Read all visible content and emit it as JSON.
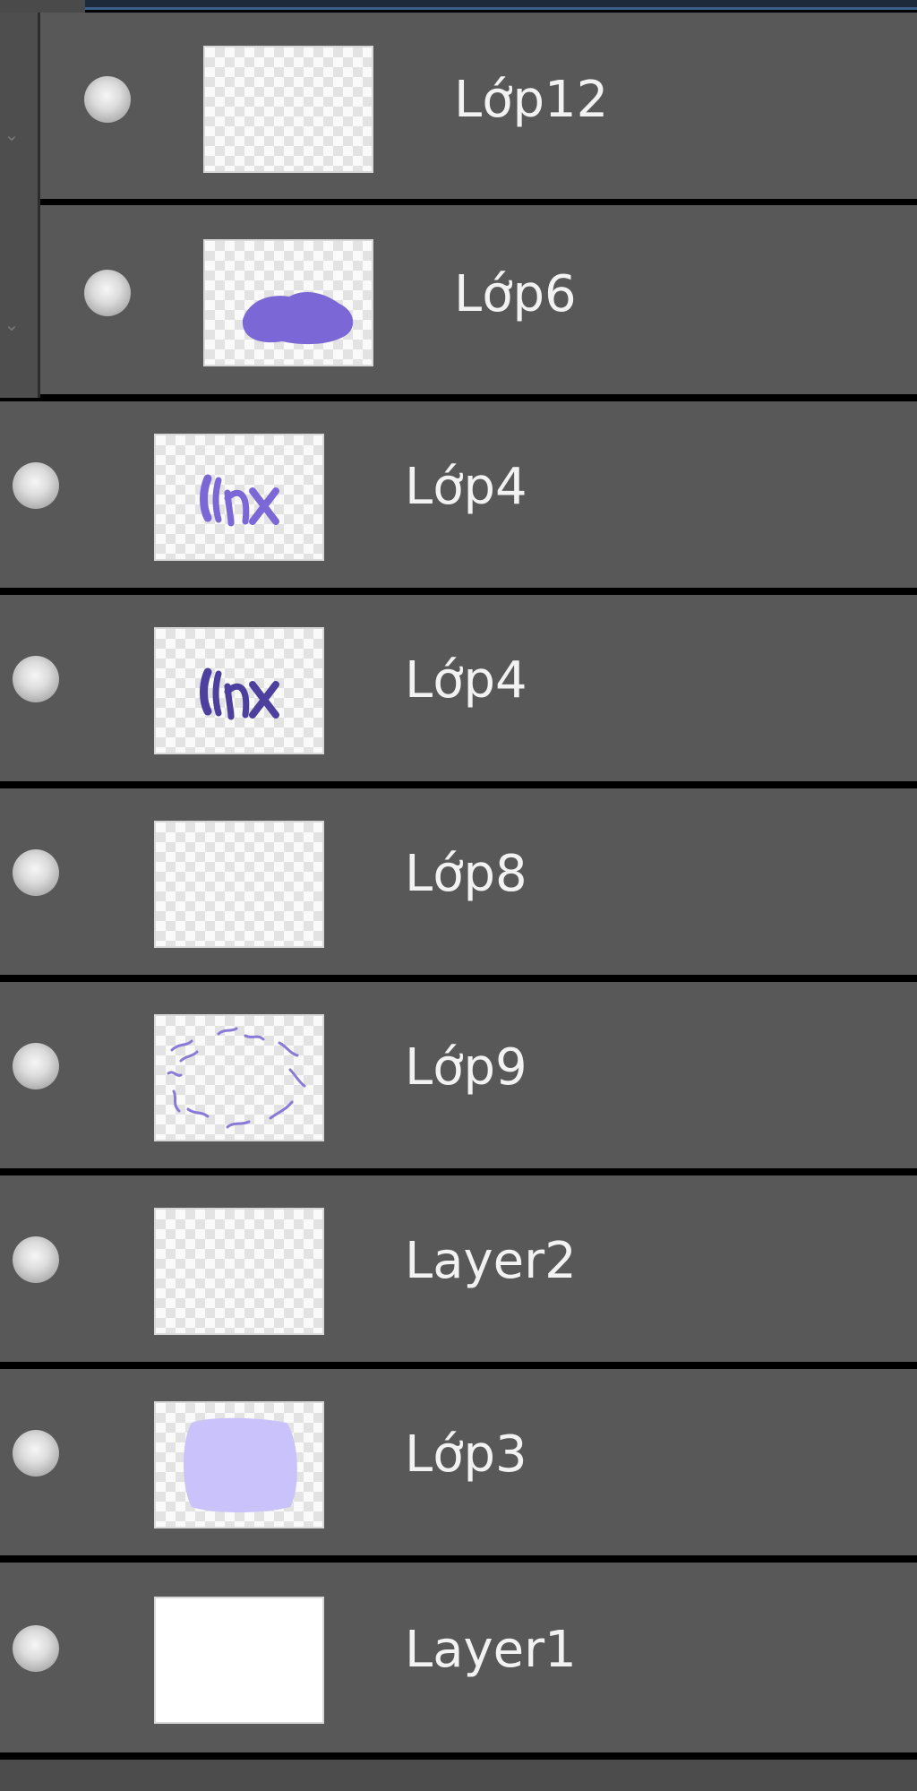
{
  "layers_panel": {
    "group": {
      "collapse_icon": "chevron-down-icon",
      "layers": [
        {
          "name": "Lớp12",
          "visible": true,
          "thumbnail": "empty"
        },
        {
          "name": "Lớp6",
          "visible": true,
          "thumbnail": "purple-blob"
        }
      ]
    },
    "layers": [
      {
        "name": "Lớp4",
        "visible": true,
        "thumbnail": "text-light"
      },
      {
        "name": "Lớp4",
        "visible": true,
        "thumbnail": "text-dark"
      },
      {
        "name": "Lớp8",
        "visible": true,
        "thumbnail": "empty"
      },
      {
        "name": "Lớp9",
        "visible": true,
        "thumbnail": "scribbles"
      },
      {
        "name": "Layer2",
        "visible": true,
        "thumbnail": "empty"
      },
      {
        "name": "Lớp3",
        "visible": true,
        "thumbnail": "lavender-fill"
      },
      {
        "name": "Layer1",
        "visible": true,
        "thumbnail": "white-fill"
      }
    ]
  },
  "colors": {
    "row_background": "#585858",
    "separator": "#000000",
    "text": "#f2f2f2",
    "accent_purple": "#7b67d6",
    "lavender": "#c9c2fb"
  }
}
